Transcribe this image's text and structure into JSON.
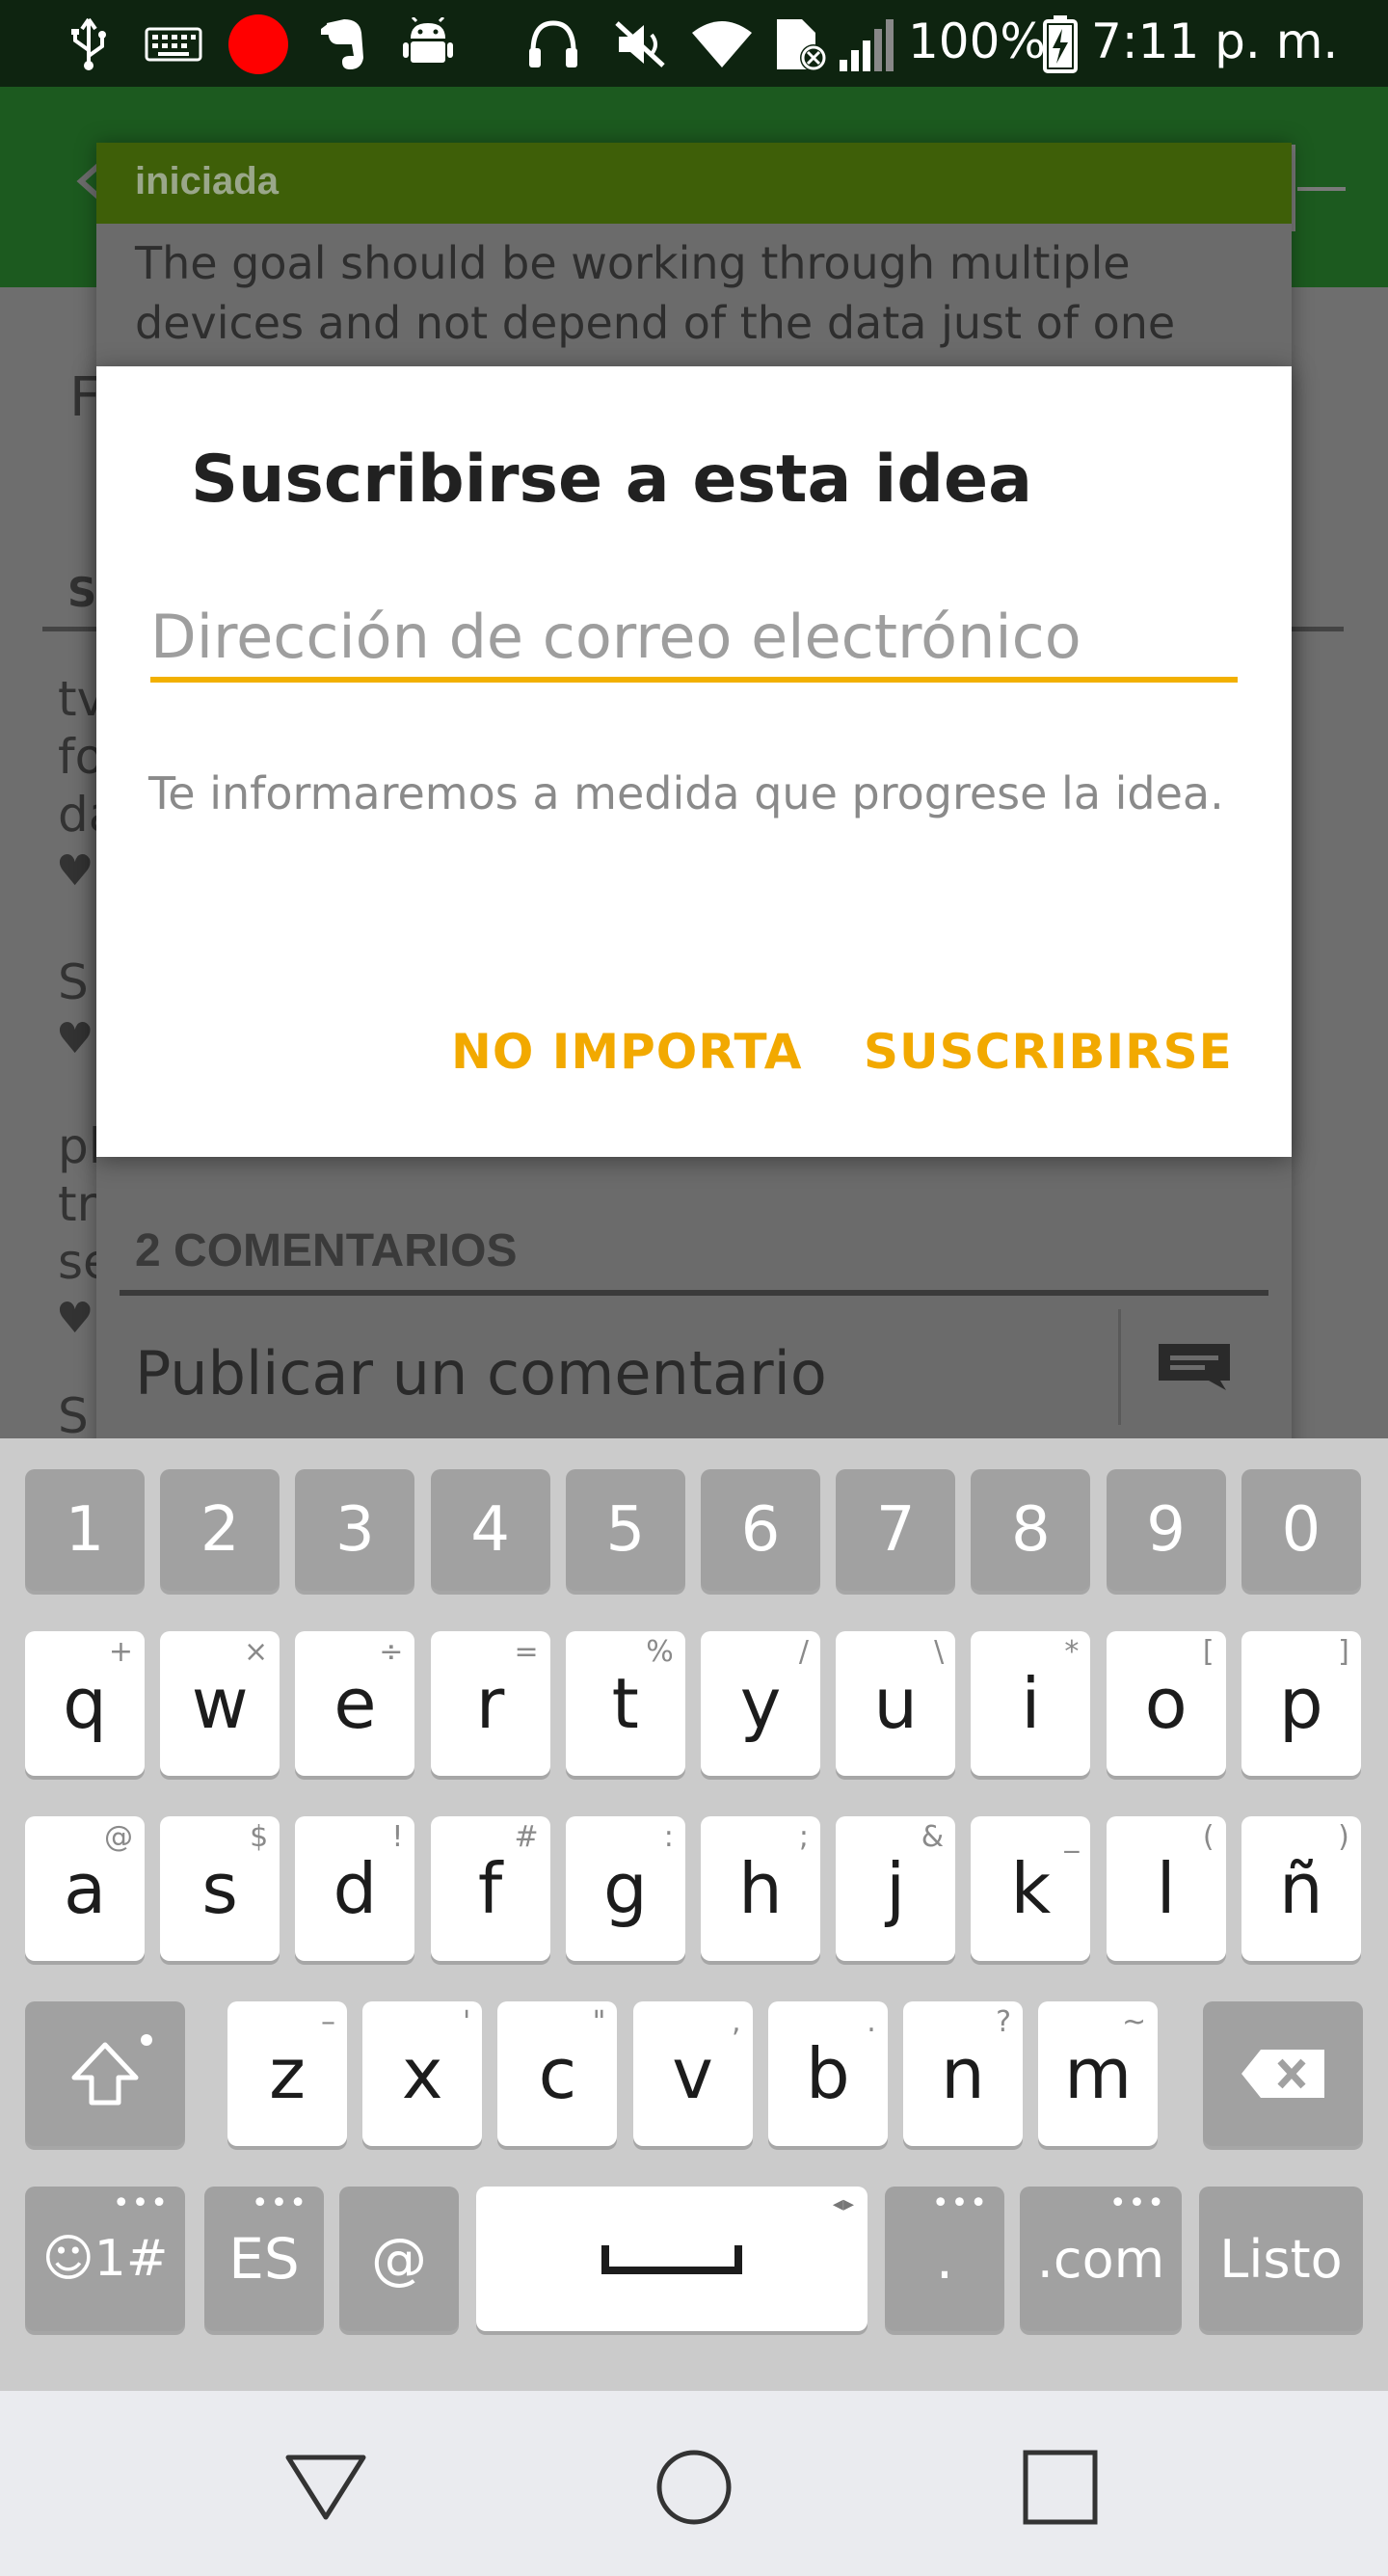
{
  "status_bar": {
    "battery": "100%",
    "time": "7:11 p. m.",
    "icons": [
      "usb-icon",
      "keyboard-icon",
      "record-dot-icon",
      "evernote-icon",
      "android-icon",
      "headphones-icon",
      "mute-icon",
      "wifi-icon",
      "no-sim-icon",
      "signal-icon",
      "battery-charging-icon"
    ]
  },
  "background": {
    "status_label": "iniciada",
    "description": "The goal should be working through multiple devices and not depend of the data just of one",
    "comments_header": "2 COMENTARIOS",
    "post_comment": "Publicar un comentario"
  },
  "dialog": {
    "title": "Suscribirse a esta idea",
    "email_placeholder": "Dirección de correo electrónico",
    "email_value": "",
    "helper_text": "Te informaremos a medida que progrese la idea.",
    "cancel_label": "NO IMPORTA",
    "confirm_label": "SUSCRIBIRSE",
    "accent_color": "#f2a900"
  },
  "keyboard": {
    "number_row": [
      "1",
      "2",
      "3",
      "4",
      "5",
      "6",
      "7",
      "8",
      "9",
      "0"
    ],
    "row1": [
      {
        "key": "q",
        "alt": "+"
      },
      {
        "key": "w",
        "alt": "×"
      },
      {
        "key": "e",
        "alt": "÷"
      },
      {
        "key": "r",
        "alt": "="
      },
      {
        "key": "t",
        "alt": "%"
      },
      {
        "key": "y",
        "alt": "/"
      },
      {
        "key": "u",
        "alt": "\\"
      },
      {
        "key": "i",
        "alt": "*"
      },
      {
        "key": "o",
        "alt": "["
      },
      {
        "key": "p",
        "alt": "]"
      }
    ],
    "row2": [
      {
        "key": "a",
        "alt": "@"
      },
      {
        "key": "s",
        "alt": "$"
      },
      {
        "key": "d",
        "alt": "!"
      },
      {
        "key": "f",
        "alt": "#"
      },
      {
        "key": "g",
        "alt": ":"
      },
      {
        "key": "h",
        "alt": ";"
      },
      {
        "key": "j",
        "alt": "&"
      },
      {
        "key": "k",
        "alt": "_"
      },
      {
        "key": "l",
        "alt": "("
      },
      {
        "key": "ñ",
        "alt": ")"
      }
    ],
    "row3": [
      {
        "key": "z",
        "alt": "–"
      },
      {
        "key": "x",
        "alt": "'"
      },
      {
        "key": "c",
        "alt": "\""
      },
      {
        "key": "v",
        "alt": ","
      },
      {
        "key": "b",
        "alt": "."
      },
      {
        "key": "n",
        "alt": "?"
      },
      {
        "key": "m",
        "alt": "~"
      }
    ],
    "bottom": {
      "symbols": "☺1#",
      "language": "ES",
      "at": "@",
      "period": ".",
      "dotcom": ".com",
      "done": "Listo"
    }
  },
  "nav_bar": {
    "icons": [
      "back-triangle-icon",
      "home-circle-icon",
      "recents-square-icon"
    ]
  }
}
